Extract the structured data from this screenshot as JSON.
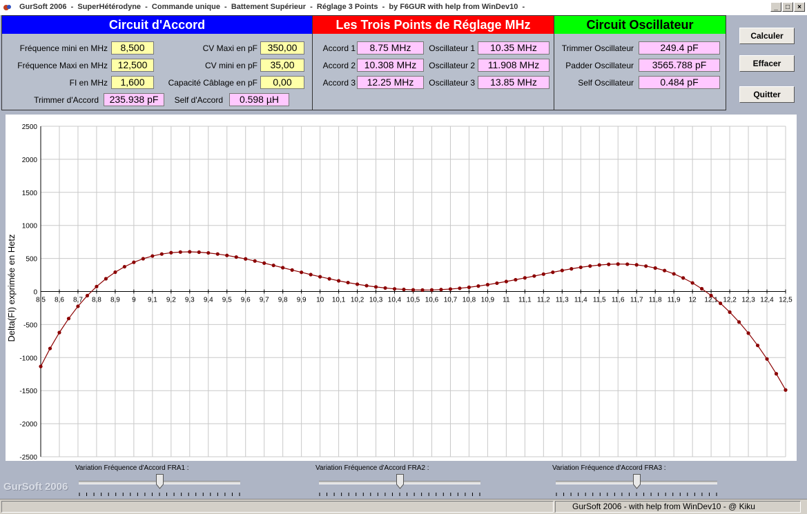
{
  "window": {
    "title": "GurSoft 2006  -  SuperHétérodyne  -  Commande unique  -  Battement Supérieur  -  Réglage 3 Points  -  by F6GUR with help from WinDev10  -"
  },
  "panel_accord": {
    "title": "Circuit d'Accord",
    "color": "#0000ff",
    "freq_min_label": "Fréquence mini en MHz",
    "freq_min_value": "8,500",
    "freq_max_label": "Fréquence Maxi en MHz",
    "freq_max_value": "12,500",
    "fi_label": "FI en MHz",
    "fi_value": "1,600",
    "cv_maxi_label": "CV Maxi en pF",
    "cv_maxi_value": "350,00",
    "cv_mini_label": "CV mini en pF",
    "cv_mini_value": "35,00",
    "capa_label": "Capacité Câblage en pF",
    "capa_value": "0,00",
    "trimmer_label": "Trimmer d'Accord",
    "trimmer_value": "235.938 pF",
    "self_label": "Self d'Accord",
    "self_value": "0.598 µH"
  },
  "panel_points": {
    "title": "Les Trois Points de Réglage MHz",
    "color": "#ff0000",
    "accord1_label": "Accord 1",
    "accord1_value": "8.75 MHz",
    "accord2_label": "Accord 2",
    "accord2_value": "10.308 MHz",
    "accord3_label": "Accord 3",
    "accord3_value": "12.25 MHz",
    "osc1_label": "Oscillateur 1",
    "osc1_value": "10.35 MHz",
    "osc2_label": "Oscillateur 2",
    "osc2_value": "11.908 MHz",
    "osc3_label": "Oscillateur 3",
    "osc3_value": "13.85 MHz"
  },
  "panel_osc": {
    "title": "Circuit Oscillateur",
    "color": "#00ff00",
    "trimmer_label": "Trimmer Oscillateur",
    "trimmer_value": "249.4 pF",
    "padder_label": "Padder Oscillateur",
    "padder_value": "3565.788 pF",
    "self_label": "Self Oscillateur",
    "self_value": "0.484 pF"
  },
  "buttons": {
    "calculer": "Calculer",
    "effacer": "Effacer",
    "quitter": "Quitter"
  },
  "sliders": [
    {
      "label": "Variation Fréquence d'Accord  FRA1 :",
      "position": 0.5
    },
    {
      "label": "Variation Fréquence d'Accord  FRA2 :",
      "position": 0.5
    },
    {
      "label": "Variation Fréquence d'Accord  FRA3 :",
      "position": 0.5
    }
  ],
  "watermark": "GurSoft 2006",
  "status": "GurSoft 2006  -  with help from WinDev10  -  @ Kiku",
  "chart_data": {
    "type": "line",
    "xlabel": "",
    "ylabel": "Delta(FI) exprimée en Hetz",
    "xlim": [
      8.5,
      12.5
    ],
    "ylim": [
      -2500,
      2500
    ],
    "x_ticks": [
      "8,5",
      "8,6",
      "8,7",
      "8,8",
      "8,9",
      "9",
      "9,1",
      "9,2",
      "9,3",
      "9,4",
      "9,5",
      "9,6",
      "9,7",
      "9,8",
      "9,9",
      "10",
      "10,1",
      "10,2",
      "10,3",
      "10,4",
      "10,5",
      "10,6",
      "10,7",
      "10,8",
      "10,9",
      "11",
      "11,1",
      "11,2",
      "11,3",
      "11,4",
      "11,5",
      "11,6",
      "11,7",
      "11,8",
      "11,9",
      "12",
      "12,1",
      "12,2",
      "12,3",
      "12,4",
      "12,5"
    ],
    "y_ticks": [
      "2500",
      "2000",
      "1500",
      "1000",
      "500",
      "0",
      "-500",
      "-1000",
      "-1500",
      "-2000",
      "-2500"
    ],
    "grid": true,
    "series_color": "#8b0000",
    "series": [
      {
        "x": [
          8.5,
          8.55,
          8.6,
          8.65,
          8.7,
          8.75,
          8.8,
          8.85,
          8.9,
          8.95,
          9.0,
          9.05,
          9.1,
          9.15,
          9.2,
          9.25,
          9.3,
          9.35,
          9.4,
          9.45,
          9.5,
          9.55,
          9.6,
          9.65,
          9.7,
          9.75,
          9.8,
          9.85,
          9.9,
          9.95,
          10.0,
          10.05,
          10.1,
          10.15,
          10.2,
          10.25,
          10.3,
          10.35,
          10.4,
          10.45,
          10.5,
          10.55,
          10.6,
          10.65,
          10.7,
          10.75,
          10.8,
          10.85,
          10.9,
          10.95,
          11.0,
          11.05,
          11.1,
          11.15,
          11.2,
          11.25,
          11.3,
          11.35,
          11.4,
          11.45,
          11.5,
          11.55,
          11.6,
          11.65,
          11.7,
          11.75,
          11.8,
          11.85,
          11.9,
          11.95,
          12.0,
          12.05,
          12.1,
          12.15,
          12.2,
          12.25,
          12.3,
          12.35,
          12.4,
          12.45,
          12.5
        ],
        "values": [
          -1134,
          -862,
          -621,
          -409,
          -224,
          -63,
          75,
          193,
          292,
          375,
          442,
          496,
          537,
          567,
          587,
          597,
          600,
          595,
          584,
          567,
          546,
          521,
          493,
          462,
          429,
          395,
          360,
          325,
          290,
          256,
          223,
          192,
          162,
          135,
          110,
          88,
          69,
          53,
          40,
          31,
          25,
          22,
          24,
          29,
          37,
          49,
          64,
          82,
          103,
          126,
          151,
          178,
          206,
          234,
          263,
          291,
          318,
          343,
          366,
          385,
          401,
          411,
          415,
          413,
          403,
          384,
          355,
          317,
          267,
          205,
          130,
          42,
          -61,
          -179,
          -312,
          -462,
          -630,
          -816,
          -1021,
          -1245,
          -1490
        ]
      }
    ]
  }
}
